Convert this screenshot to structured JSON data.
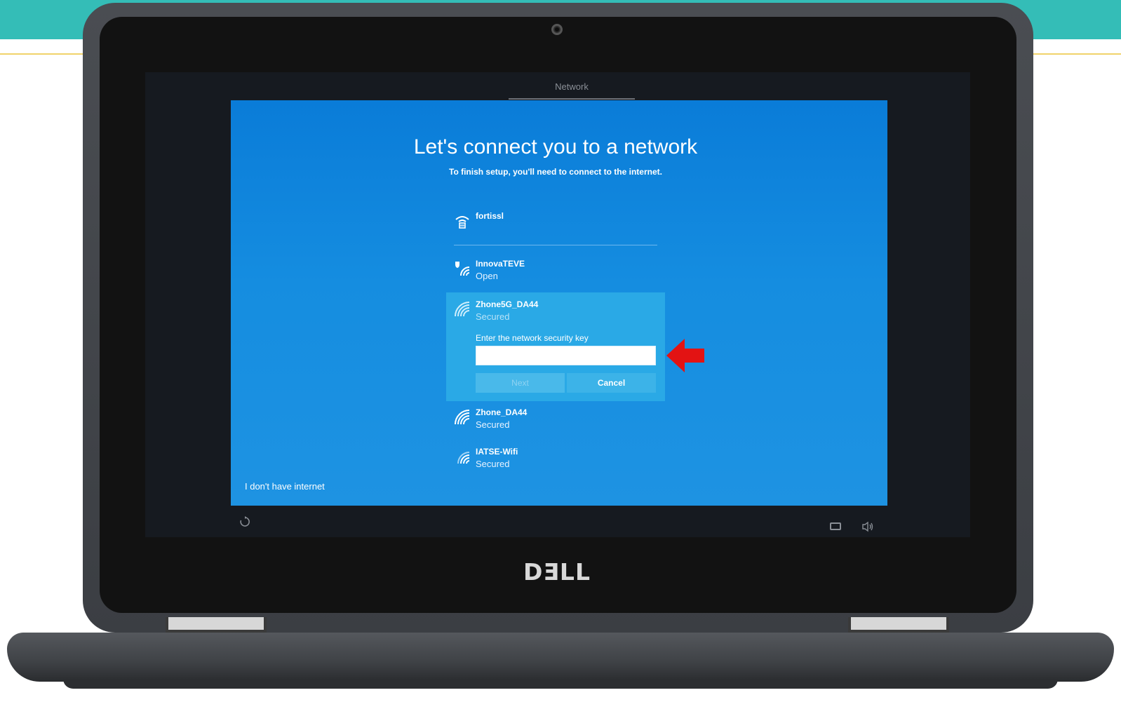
{
  "oobe": {
    "tab_label": "Network",
    "title": "Let's connect you to a network",
    "subtitle": "To finish setup, you'll need to connect to the internet.",
    "no_internet_link": "I don't have internet"
  },
  "networks": [
    {
      "name": "fortissl",
      "status": "",
      "icon": "ethernet-icon"
    },
    {
      "name": "InnovaTEVE",
      "status": "Open",
      "icon": "wifi-shield-icon"
    },
    {
      "name": "Zhone5G_DA44",
      "status": "Secured",
      "icon": "wifi-secured-icon"
    },
    {
      "name": "Zhone_DA44",
      "status": "Secured",
      "icon": "wifi-secured-icon"
    },
    {
      "name": "IATSE-Wifi",
      "status": "Secured",
      "icon": "wifi-secured-icon"
    }
  ],
  "selected_network": {
    "key_label": "Enter the network security key",
    "key_value": "",
    "next_label": "Next",
    "cancel_label": "Cancel"
  },
  "device": {
    "brand": "DƎLL"
  },
  "tray_icons": [
    "ease-of-access-icon",
    "keyboard-icon",
    "volume-icon"
  ],
  "annotation": {
    "arrow_color": "#e31313"
  },
  "colors": {
    "banner": "#34bdb7",
    "oobe_background": "#1589de",
    "selected_network": "#2aa9e6"
  }
}
